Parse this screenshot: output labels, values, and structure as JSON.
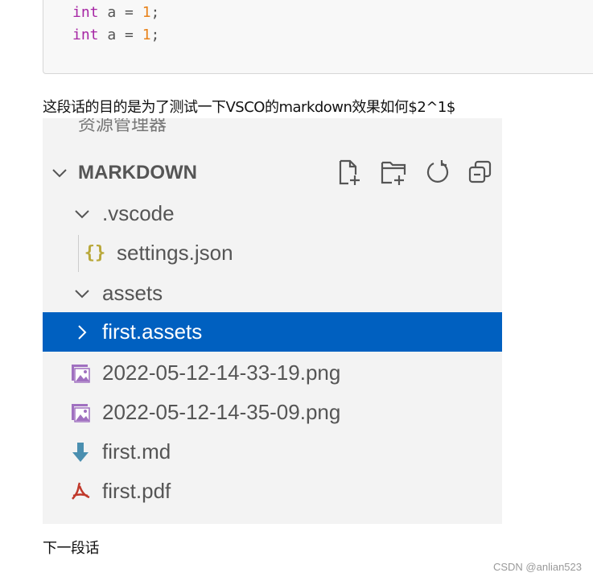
{
  "code_block": {
    "lines": [
      {
        "keyword": "int",
        "rest": " a = ",
        "number": "1",
        "end": ";"
      },
      {
        "keyword": "int",
        "rest": " a = ",
        "number": "1",
        "end": ";"
      }
    ]
  },
  "paragraph1": "这段话的目的是为了测试一下VSCO的markdown效果如何$2^1$",
  "explorer": {
    "header": "资源管理器",
    "more": "···",
    "section": "MARKDOWN",
    "actions": [
      "new-file",
      "new-folder",
      "refresh",
      "collapse-all"
    ],
    "items": [
      {
        "label": ".vscode",
        "icon": "chevron-down"
      },
      {
        "label": "settings.json",
        "icon": "json-braces"
      },
      {
        "label": "assets",
        "icon": "chevron-down"
      },
      {
        "label": "first.assets",
        "icon": "chevron-right",
        "selected": true
      },
      {
        "label": "2022-05-12-14-33-19.png",
        "icon": "image"
      },
      {
        "label": "2022-05-12-14-35-09.png",
        "icon": "image"
      },
      {
        "label": "first.md",
        "icon": "markdown-arrow"
      },
      {
        "label": "first.pdf",
        "icon": "pdf"
      }
    ],
    "selection_color": "#0060c0"
  },
  "paragraph2": "下一段话",
  "watermark": "CSDN @anlian523"
}
